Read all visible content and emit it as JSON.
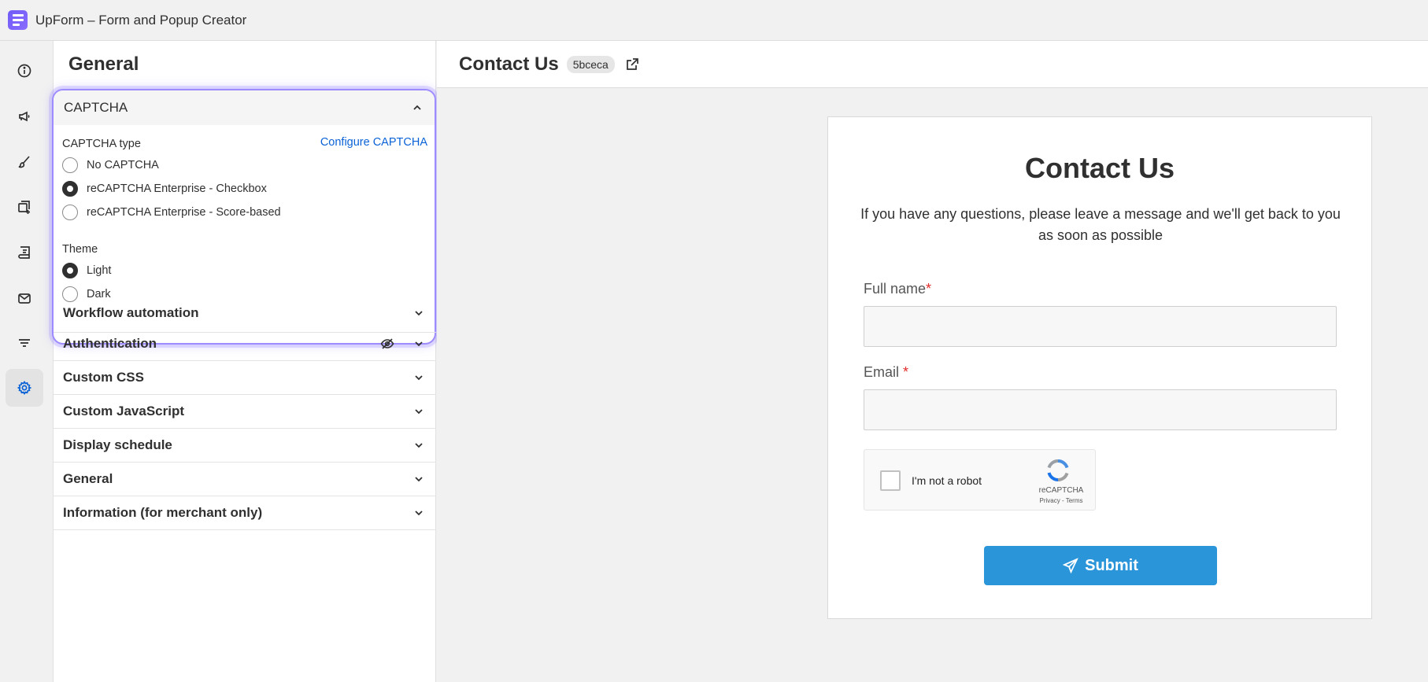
{
  "app": {
    "title": "UpForm – Form and Popup Creator",
    "logo_icon": "upform-logo-icon"
  },
  "rail": {
    "items": [
      {
        "icon": "info-icon"
      },
      {
        "icon": "megaphone-icon"
      },
      {
        "icon": "paintbrush-icon"
      },
      {
        "icon": "add-field-icon"
      },
      {
        "icon": "submissions-icon"
      },
      {
        "icon": "mail-icon"
      },
      {
        "icon": "filter-lines-icon"
      },
      {
        "icon": "gear-icon",
        "active": true
      }
    ]
  },
  "panel": {
    "title": "General",
    "captcha": {
      "header": "CAPTCHA",
      "type_label": "CAPTCHA type",
      "configure_link": "Configure CAPTCHA",
      "type_options": [
        {
          "label": "No CAPTCHA",
          "checked": false
        },
        {
          "label": "reCAPTCHA Enterprise - Checkbox",
          "checked": true
        },
        {
          "label": "reCAPTCHA Enterprise - Score-based",
          "checked": false
        }
      ],
      "theme_label": "Theme",
      "theme_options": [
        {
          "label": "Light",
          "checked": true
        },
        {
          "label": "Dark",
          "checked": false
        }
      ]
    },
    "sections": [
      {
        "label": "Workflow automation"
      },
      {
        "label": "Authentication",
        "hidden_icon": true
      },
      {
        "label": "Custom CSS"
      },
      {
        "label": "Custom JavaScript"
      },
      {
        "label": "Display schedule"
      },
      {
        "label": "General"
      },
      {
        "label": "Information (for merchant only)"
      }
    ]
  },
  "main": {
    "title": "Contact Us",
    "id_badge": "5bceca",
    "form": {
      "title": "Contact Us",
      "description": "If you have any questions, please leave a message and we'll get back to you as soon as possible",
      "fields": [
        {
          "label": "Full name",
          "required_mark": "*"
        },
        {
          "label": "Email",
          "required_mark": "*"
        }
      ],
      "recaptcha": {
        "checkbox_label": "I'm not a robot",
        "brand": "reCAPTCHA",
        "links": "Privacy - Terms"
      },
      "submit_label": "Submit"
    }
  },
  "colors": {
    "accent_purple": "#9d8cff",
    "link_blue": "#0a63d6",
    "submit_blue": "#2b95da",
    "required_red": "#e22b2b"
  }
}
